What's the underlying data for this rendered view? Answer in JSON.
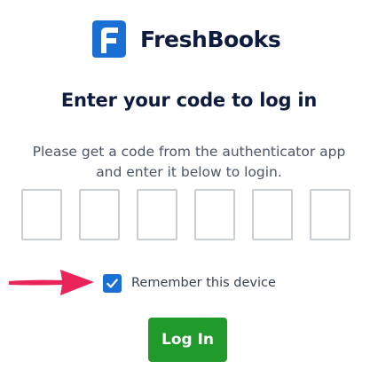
{
  "brand": {
    "name": "FreshBooks",
    "icon": "freshbooks-logo-icon",
    "color": "#0d1b3e",
    "logo_color": "#1a6fd4"
  },
  "heading": "Enter your code to log in",
  "instructions": "Please get a code from the authenticator app and enter it below to login.",
  "code_inputs": [
    "",
    "",
    "",
    "",
    "",
    ""
  ],
  "remember": {
    "label": "Remember this device",
    "checked": true,
    "checkbox_color": "#1a6fd4"
  },
  "annotation": {
    "icon": "arrow-right-icon",
    "color": "#e8245a"
  },
  "login_button": {
    "label": "Log In",
    "color": "#1f9a2b"
  }
}
